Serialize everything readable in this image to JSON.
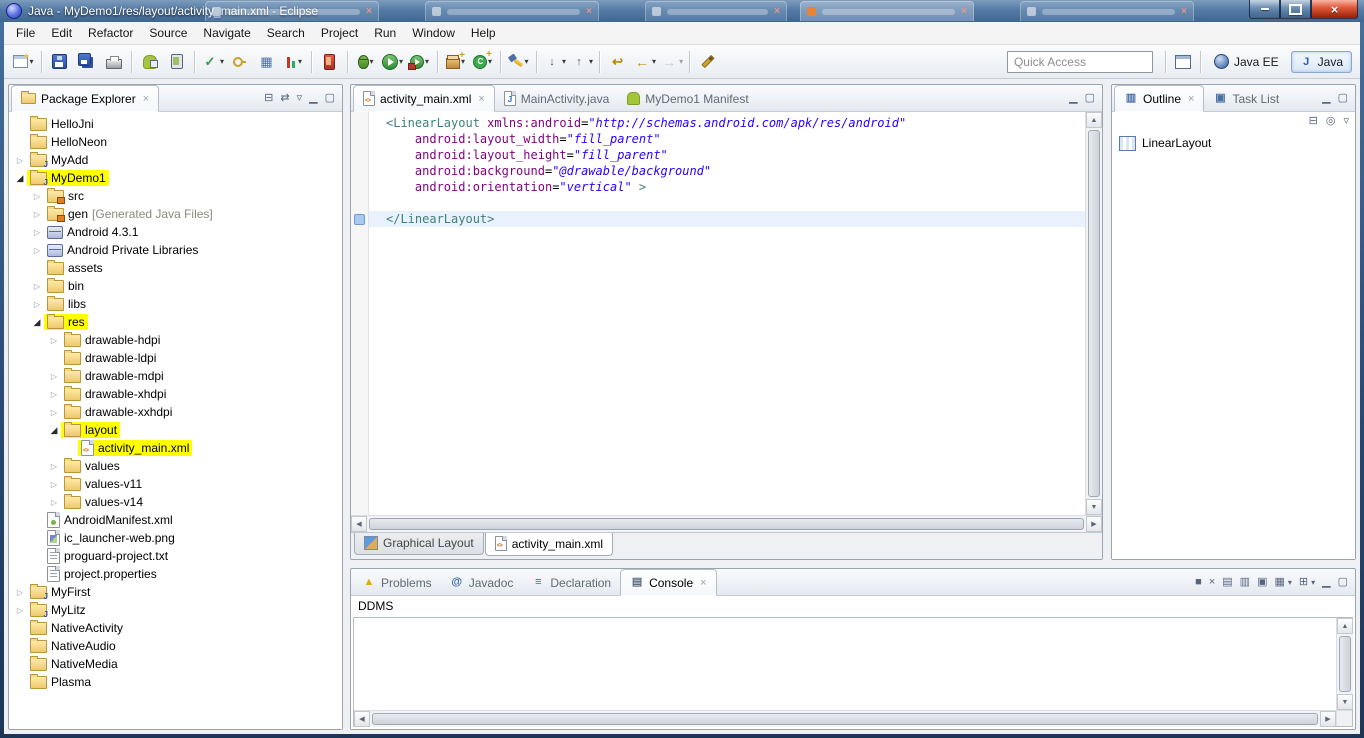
{
  "titlebar": {
    "title": "Java - MyDemo1/res/layout/activity_main.xml - Eclipse"
  },
  "menu_bar": {
    "items": [
      "File",
      "Edit",
      "Refactor",
      "Source",
      "Navigate",
      "Search",
      "Project",
      "Run",
      "Window",
      "Help"
    ]
  },
  "toolbar": {
    "quick_access": {
      "placeholder": "Quick Access"
    },
    "perspectives": [
      {
        "label": "Java EE",
        "icon": "javaee",
        "active": false
      },
      {
        "label": "Java",
        "icon": "java",
        "active": true
      }
    ],
    "groups": [
      [
        {
          "name": "new-wizard",
          "dropdown": true
        }
      ],
      [
        {
          "name": "save"
        },
        {
          "name": "save-all"
        },
        {
          "name": "print"
        }
      ],
      [
        {
          "name": "android-sdk-manager"
        },
        {
          "name": "android-virtual-device-manager"
        }
      ],
      [
        {
          "name": "junit-run",
          "dropdown": true
        },
        {
          "name": "secure-key"
        },
        {
          "name": "dashboard"
        },
        {
          "name": "coverage",
          "dropdown": true
        }
      ],
      [
        {
          "name": "ddms-device"
        }
      ],
      [
        {
          "name": "debug",
          "dropdown": true
        },
        {
          "name": "run",
          "dropdown": true
        },
        {
          "name": "external-tools",
          "dropdown": true
        }
      ],
      [
        {
          "name": "new-java-package",
          "dropdown": true
        },
        {
          "name": "new-java-class",
          "dropdown": true
        }
      ],
      [
        {
          "name": "search",
          "dropdown": true
        }
      ],
      [
        {
          "name": "next-annotation",
          "dropdown": true
        },
        {
          "name": "previous-annotation",
          "dropdown": true
        }
      ],
      [
        {
          "name": "last-edit-location"
        },
        {
          "name": "back",
          "dropdown": true
        },
        {
          "name": "forward",
          "dropdown": true,
          "disabled": true
        }
      ],
      [
        {
          "name": "pencil"
        }
      ]
    ]
  },
  "package_explorer": {
    "title": "Package Explorer",
    "tools": [
      "collapse-all",
      "link-with-editor",
      "view-menu",
      "minimize",
      "maximize"
    ],
    "items": [
      {
        "label": "HelloJni",
        "depth": 0,
        "icon": "project"
      },
      {
        "label": "HelloNeon",
        "depth": 0,
        "icon": "project"
      },
      {
        "label": "MyAdd",
        "depth": 0,
        "icon": "java-project",
        "expander": "closed"
      },
      {
        "label": "MyDemo1",
        "depth": 0,
        "icon": "java-project",
        "expander": "open",
        "highlight": true
      },
      {
        "label": "src",
        "depth": 1,
        "icon": "source-folder",
        "expander": "closed"
      },
      {
        "label": "gen",
        "suffix": " [Generated Java Files]",
        "depth": 1,
        "icon": "source-folder",
        "expander": "closed"
      },
      {
        "label": "Android 4.3.1",
        "depth": 1,
        "icon": "library",
        "expander": "closed"
      },
      {
        "label": "Android Private Libraries",
        "depth": 1,
        "icon": "library",
        "expander": "closed"
      },
      {
        "label": "assets",
        "depth": 1,
        "icon": "folder"
      },
      {
        "label": "bin",
        "depth": 1,
        "icon": "folder",
        "expander": "closed"
      },
      {
        "label": "libs",
        "depth": 1,
        "icon": "folder",
        "expander": "closed"
      },
      {
        "label": "res",
        "depth": 1,
        "icon": "folder",
        "expander": "open",
        "highlight": true
      },
      {
        "label": "drawable-hdpi",
        "depth": 2,
        "icon": "folder",
        "expander": "closed"
      },
      {
        "label": "drawable-ldpi",
        "depth": 2,
        "icon": "folder"
      },
      {
        "label": "drawable-mdpi",
        "depth": 2,
        "icon": "folder",
        "expander": "closed"
      },
      {
        "label": "drawable-xhdpi",
        "depth": 2,
        "icon": "folder",
        "expander": "closed"
      },
      {
        "label": "drawable-xxhdpi",
        "depth": 2,
        "icon": "folder",
        "expander": "closed"
      },
      {
        "label": "layout",
        "depth": 2,
        "icon": "folder",
        "expander": "open",
        "highlight": true
      },
      {
        "label": "activity_main.xml",
        "depth": 3,
        "icon": "xml-file",
        "highlight": true
      },
      {
        "label": "values",
        "depth": 2,
        "icon": "folder",
        "expander": "closed"
      },
      {
        "label": "values-v11",
        "depth": 2,
        "icon": "folder",
        "expander": "closed"
      },
      {
        "label": "values-v14",
        "depth": 2,
        "icon": "folder",
        "expander": "closed"
      },
      {
        "label": "AndroidManifest.xml",
        "depth": 1,
        "icon": "manifest-file"
      },
      {
        "label": "ic_launcher-web.png",
        "depth": 1,
        "icon": "image-file"
      },
      {
        "label": "proguard-project.txt",
        "depth": 1,
        "icon": "text-file"
      },
      {
        "label": "project.properties",
        "depth": 1,
        "icon": "text-file"
      },
      {
        "label": "MyFirst",
        "depth": 0,
        "icon": "java-project",
        "expander": "closed"
      },
      {
        "label": "MyLitz",
        "depth": 0,
        "icon": "java-project",
        "expander": "closed"
      },
      {
        "label": "NativeActivity",
        "depth": 0,
        "icon": "project"
      },
      {
        "label": "NativeAudio",
        "depth": 0,
        "icon": "project"
      },
      {
        "label": "NativeMedia",
        "depth": 0,
        "icon": "project"
      },
      {
        "label": "Plasma",
        "depth": 0,
        "icon": "project"
      }
    ]
  },
  "editor": {
    "tabs": [
      {
        "label": "activity_main.xml",
        "icon": "xml",
        "active": true,
        "closable": true
      },
      {
        "label": "MainActivity.java",
        "icon": "java"
      },
      {
        "label": "MyDemo1 Manifest",
        "icon": "manifest"
      }
    ],
    "header_tools": [
      "minimize",
      "maximize"
    ],
    "bottom_tabs": [
      {
        "label": "Graphical Layout",
        "icon": "palette"
      },
      {
        "label": "activity_main.xml",
        "icon": "xml",
        "active": true
      }
    ],
    "code": {
      "lines": [
        {
          "segs": [
            [
              "tag",
              "<LinearLayout"
            ],
            [
              "pl",
              " "
            ],
            [
              "attr",
              "xmlns:android"
            ],
            [
              "pl",
              "="
            ],
            [
              "val",
              "\"http://schemas.android.com/apk/res/android\""
            ]
          ]
        },
        {
          "segs": [
            [
              "pl",
              "    "
            ],
            [
              "attr",
              "android:layout_width"
            ],
            [
              "pl",
              "="
            ],
            [
              "val",
              "\"fill_parent\""
            ]
          ]
        },
        {
          "segs": [
            [
              "pl",
              "    "
            ],
            [
              "attr",
              "android:layout_height"
            ],
            [
              "pl",
              "="
            ],
            [
              "val",
              "\"fill_parent\""
            ]
          ]
        },
        {
          "segs": [
            [
              "pl",
              "    "
            ],
            [
              "attr",
              "android:background"
            ],
            [
              "pl",
              "="
            ],
            [
              "val",
              "\"@drawable/background\""
            ]
          ]
        },
        {
          "segs": [
            [
              "pl",
              "    "
            ],
            [
              "attr",
              "android:orientation"
            ],
            [
              "pl",
              "="
            ],
            [
              "val",
              "\"vertical\""
            ],
            [
              "pl",
              " "
            ],
            [
              "tag",
              ">"
            ]
          ]
        },
        {
          "segs": []
        },
        {
          "segs": [
            [
              "tag",
              "</LinearLayout>"
            ]
          ],
          "current": true,
          "marker": true
        }
      ]
    }
  },
  "outline": {
    "tabs": [
      {
        "label": "Outline",
        "icon": "outline",
        "active": true,
        "closable": true
      },
      {
        "label": "Task List",
        "icon": "tasklist"
      }
    ],
    "header_tools": [
      "minimize",
      "maximize"
    ],
    "tools": [
      "collapse-all",
      "focus",
      "view-menu"
    ],
    "items": [
      {
        "label": "LinearLayout",
        "icon": "linearlayout"
      }
    ]
  },
  "console": {
    "tabs": [
      {
        "label": "Problems",
        "icon": "problems"
      },
      {
        "label": "Javadoc",
        "icon": "javadoc"
      },
      {
        "label": "Declaration",
        "icon": "declaration"
      },
      {
        "label": "Console",
        "icon": "console",
        "active": true,
        "closable": true
      }
    ],
    "title": "DDMS",
    "tools": [
      "terminate",
      "remove-launch",
      "clear-console",
      "scroll-lock",
      "pin-console",
      "display-console",
      "open-console",
      "minimize",
      "maximize"
    ]
  },
  "colors": {
    "highlight": "#ffff00",
    "xml_tag": "#3f7f7f",
    "xml_attribute": "#7f007f",
    "xml_value": "#2a00ff",
    "current_line": "#e9f2fc"
  }
}
